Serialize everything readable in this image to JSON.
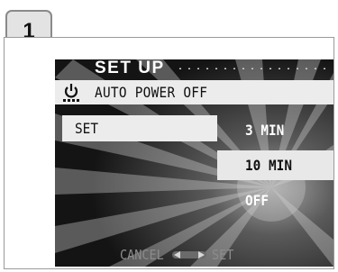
{
  "step": {
    "number": "1"
  },
  "screen": {
    "title": "SET UP",
    "header": {
      "icon": "power-icon",
      "label": "AUTO POWER OFF"
    },
    "set_label": "SET",
    "options": [
      {
        "label": "3 MIN",
        "selected": false
      },
      {
        "label": "10 MIN",
        "selected": true
      },
      {
        "label": "OFF",
        "selected": false
      }
    ],
    "footer": {
      "cancel_label": "CANCEL",
      "set_label": "SET",
      "nav_icon": "left-right-arrows-icon"
    }
  },
  "colors": {
    "highlight": "#ececec",
    "screen_bg": "#121212",
    "footer_text": "#8c8c8c"
  }
}
